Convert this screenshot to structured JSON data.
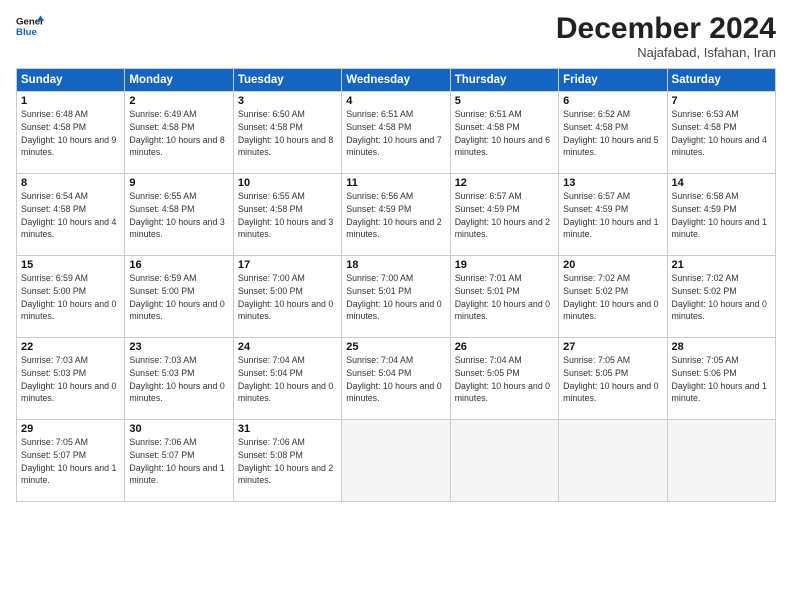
{
  "logo": {
    "line1": "General",
    "line2": "Blue"
  },
  "title": "December 2024",
  "location": "Najafabad, Isfahan, Iran",
  "days_of_week": [
    "Sunday",
    "Monday",
    "Tuesday",
    "Wednesday",
    "Thursday",
    "Friday",
    "Saturday"
  ],
  "weeks": [
    [
      {
        "day": 1,
        "rise": "6:48 AM",
        "set": "4:58 PM",
        "daylight": "10 hours and 9 minutes."
      },
      {
        "day": 2,
        "rise": "6:49 AM",
        "set": "4:58 PM",
        "daylight": "10 hours and 8 minutes."
      },
      {
        "day": 3,
        "rise": "6:50 AM",
        "set": "4:58 PM",
        "daylight": "10 hours and 8 minutes."
      },
      {
        "day": 4,
        "rise": "6:51 AM",
        "set": "4:58 PM",
        "daylight": "10 hours and 7 minutes."
      },
      {
        "day": 5,
        "rise": "6:51 AM",
        "set": "4:58 PM",
        "daylight": "10 hours and 6 minutes."
      },
      {
        "day": 6,
        "rise": "6:52 AM",
        "set": "4:58 PM",
        "daylight": "10 hours and 5 minutes."
      },
      {
        "day": 7,
        "rise": "6:53 AM",
        "set": "4:58 PM",
        "daylight": "10 hours and 4 minutes."
      }
    ],
    [
      {
        "day": 8,
        "rise": "6:54 AM",
        "set": "4:58 PM",
        "daylight": "10 hours and 4 minutes."
      },
      {
        "day": 9,
        "rise": "6:55 AM",
        "set": "4:58 PM",
        "daylight": "10 hours and 3 minutes."
      },
      {
        "day": 10,
        "rise": "6:55 AM",
        "set": "4:58 PM",
        "daylight": "10 hours and 3 minutes."
      },
      {
        "day": 11,
        "rise": "6:56 AM",
        "set": "4:59 PM",
        "daylight": "10 hours and 2 minutes."
      },
      {
        "day": 12,
        "rise": "6:57 AM",
        "set": "4:59 PM",
        "daylight": "10 hours and 2 minutes."
      },
      {
        "day": 13,
        "rise": "6:57 AM",
        "set": "4:59 PM",
        "daylight": "10 hours and 1 minute."
      },
      {
        "day": 14,
        "rise": "6:58 AM",
        "set": "4:59 PM",
        "daylight": "10 hours and 1 minute."
      }
    ],
    [
      {
        "day": 15,
        "rise": "6:59 AM",
        "set": "5:00 PM",
        "daylight": "10 hours and 0 minutes."
      },
      {
        "day": 16,
        "rise": "6:59 AM",
        "set": "5:00 PM",
        "daylight": "10 hours and 0 minutes."
      },
      {
        "day": 17,
        "rise": "7:00 AM",
        "set": "5:00 PM",
        "daylight": "10 hours and 0 minutes."
      },
      {
        "day": 18,
        "rise": "7:00 AM",
        "set": "5:01 PM",
        "daylight": "10 hours and 0 minutes."
      },
      {
        "day": 19,
        "rise": "7:01 AM",
        "set": "5:01 PM",
        "daylight": "10 hours and 0 minutes."
      },
      {
        "day": 20,
        "rise": "7:02 AM",
        "set": "5:02 PM",
        "daylight": "10 hours and 0 minutes."
      },
      {
        "day": 21,
        "rise": "7:02 AM",
        "set": "5:02 PM",
        "daylight": "10 hours and 0 minutes."
      }
    ],
    [
      {
        "day": 22,
        "rise": "7:03 AM",
        "set": "5:03 PM",
        "daylight": "10 hours and 0 minutes."
      },
      {
        "day": 23,
        "rise": "7:03 AM",
        "set": "5:03 PM",
        "daylight": "10 hours and 0 minutes."
      },
      {
        "day": 24,
        "rise": "7:04 AM",
        "set": "5:04 PM",
        "daylight": "10 hours and 0 minutes."
      },
      {
        "day": 25,
        "rise": "7:04 AM",
        "set": "5:04 PM",
        "daylight": "10 hours and 0 minutes."
      },
      {
        "day": 26,
        "rise": "7:04 AM",
        "set": "5:05 PM",
        "daylight": "10 hours and 0 minutes."
      },
      {
        "day": 27,
        "rise": "7:05 AM",
        "set": "5:05 PM",
        "daylight": "10 hours and 0 minutes."
      },
      {
        "day": 28,
        "rise": "7:05 AM",
        "set": "5:06 PM",
        "daylight": "10 hours and 1 minute."
      }
    ],
    [
      {
        "day": 29,
        "rise": "7:05 AM",
        "set": "5:07 PM",
        "daylight": "10 hours and 1 minute."
      },
      {
        "day": 30,
        "rise": "7:06 AM",
        "set": "5:07 PM",
        "daylight": "10 hours and 1 minute."
      },
      {
        "day": 31,
        "rise": "7:06 AM",
        "set": "5:08 PM",
        "daylight": "10 hours and 2 minutes."
      },
      null,
      null,
      null,
      null
    ]
  ]
}
